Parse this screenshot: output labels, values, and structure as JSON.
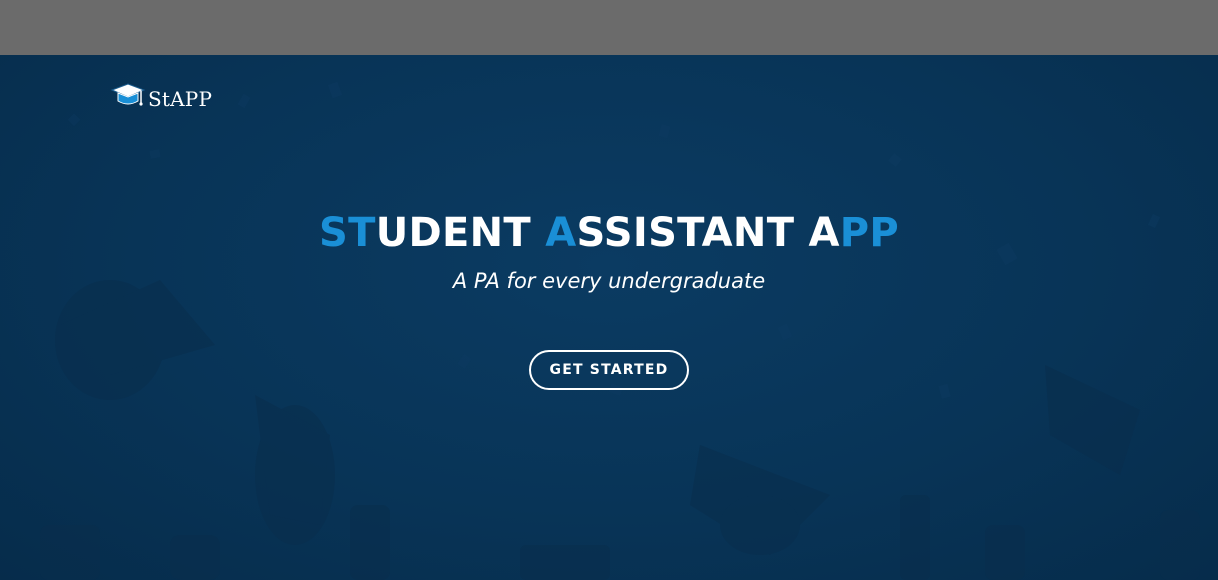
{
  "logo": {
    "icon": "graduation-cap-icon",
    "text": "StAPP"
  },
  "hero": {
    "headline_parts": [
      {
        "text": "ST",
        "accent": true
      },
      {
        "text": "UDENT ",
        "accent": false
      },
      {
        "text": "A",
        "accent": true
      },
      {
        "text": "SSISTANT A",
        "accent": false
      },
      {
        "text": "PP",
        "accent": true
      }
    ],
    "tagline": "A PA for every undergraduate",
    "cta_label": "GET STARTED"
  },
  "colors": {
    "topbar": "#6b6b6b",
    "hero_background": "#083457",
    "accent": "#1a8fd6",
    "text": "#ffffff"
  }
}
